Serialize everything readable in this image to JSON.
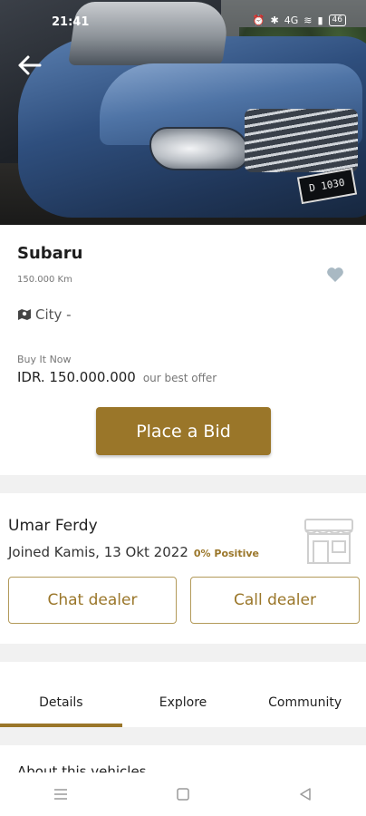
{
  "status": {
    "time": "21:41",
    "network": "4G",
    "battery": "46"
  },
  "listing": {
    "title": "Subaru",
    "mileage": "150.000 Km",
    "city": "City -",
    "buy_label": "Buy It Now",
    "price": "IDR. 150.000.000",
    "offer_note": "our best offer",
    "bid_button": "Place a Bid",
    "plate": "D 1030"
  },
  "dealer": {
    "name": "Umar Ferdy",
    "joined": "Joined Kamis, 13 Okt 2022",
    "positive": "0% Positive",
    "chat_button": "Chat dealer",
    "call_button": "Call dealer"
  },
  "tabs": [
    {
      "label": "Details",
      "active": true
    },
    {
      "label": "Explore",
      "active": false
    },
    {
      "label": "Community",
      "active": false
    }
  ],
  "section": {
    "about_title": "About this vehicles"
  },
  "colors": {
    "accent": "#9a7629",
    "button_border": "#b39a5a",
    "divider": "#f1f1f1",
    "favorite": "#a9b9c3"
  },
  "icons": {
    "back": "back-arrow-icon",
    "favorite": "heart-icon",
    "location": "map-icon",
    "store": "store-icon",
    "nav_menu": "menu-icon",
    "nav_home": "square-home-icon",
    "nav_back": "triangle-back-icon"
  }
}
